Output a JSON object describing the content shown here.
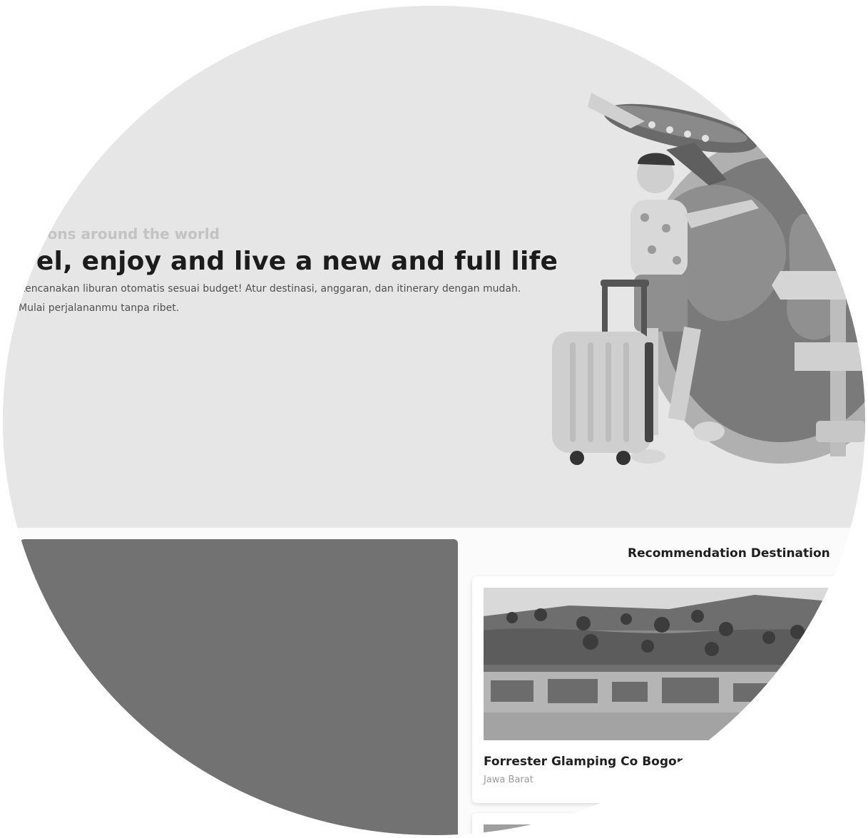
{
  "hero": {
    "eyebrow": "Destinations around the world",
    "title": "Travel, enjoy and live a new and full life",
    "description": "Rencanakan liburan otomatis sesuai budget! Atur destinasi, anggaran, dan itinerary dengan mudah. Mulai perjalananmu tanpa ribet."
  },
  "recommendation": {
    "heading": "Recommendation Destination",
    "cards": [
      {
        "name": "Forrester Glamping Co Bogor",
        "location": "Jawa Barat"
      }
    ]
  }
}
